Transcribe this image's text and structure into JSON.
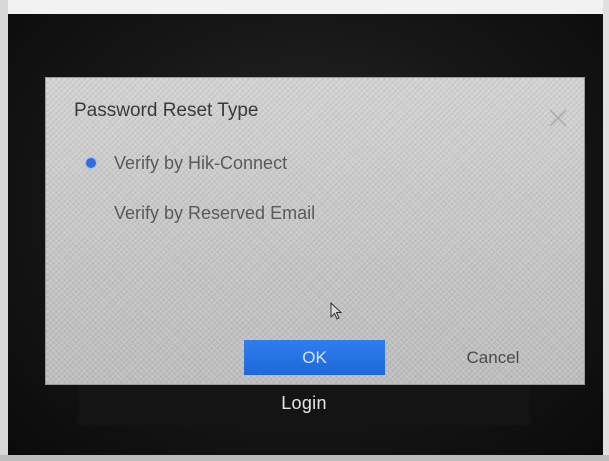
{
  "dialog": {
    "title": "Password Reset Type",
    "options": [
      {
        "label": "Verify by Hik-Connect",
        "selected": true
      },
      {
        "label": "Verify by Reserved Email",
        "selected": false
      }
    ],
    "ok_label": "OK",
    "cancel_label": "Cancel"
  },
  "background": {
    "login_label": "Login"
  },
  "icons": {
    "close": "close-icon",
    "radio_selected": "radio-selected-icon",
    "cursor": "mouse-cursor-icon"
  },
  "colors": {
    "accent": "#1f6fe0",
    "dialog_bg": "#c9c9c9",
    "screen_bg": "#161617"
  }
}
